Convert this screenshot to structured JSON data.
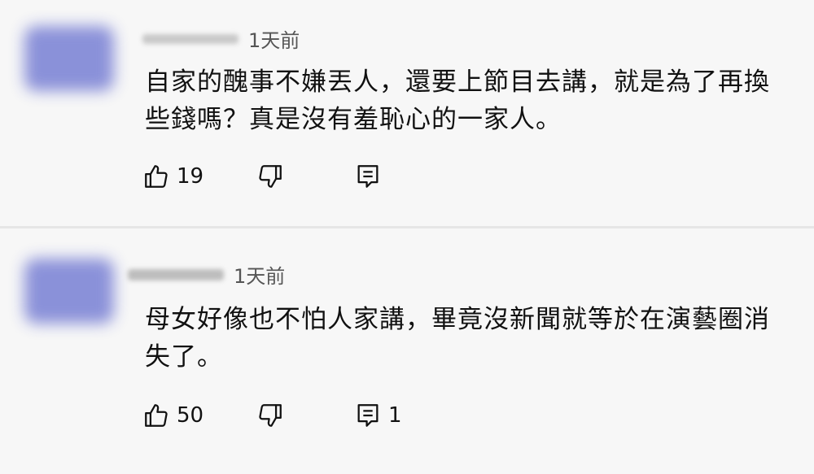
{
  "comments": [
    {
      "time": "1天前",
      "text": "自家的醜事不嫌丟人，還要上節目去講，就是為了再換些錢嗎？真是沒有羞恥心的一家人。",
      "likes": "19",
      "replies": ""
    },
    {
      "time": "1天前",
      "text": "母女好像也不怕人家講，畢竟沒新聞就等於在演藝圈消失了。",
      "likes": "50",
      "replies": "1"
    }
  ],
  "icons": {
    "like": "thumbs-up-icon",
    "dislike": "thumbs-down-icon",
    "reply": "reply-comment-icon"
  },
  "colors": {
    "avatar": "#7f86d6",
    "background": "#f7f7f7",
    "divider": "#e6e6e6"
  }
}
